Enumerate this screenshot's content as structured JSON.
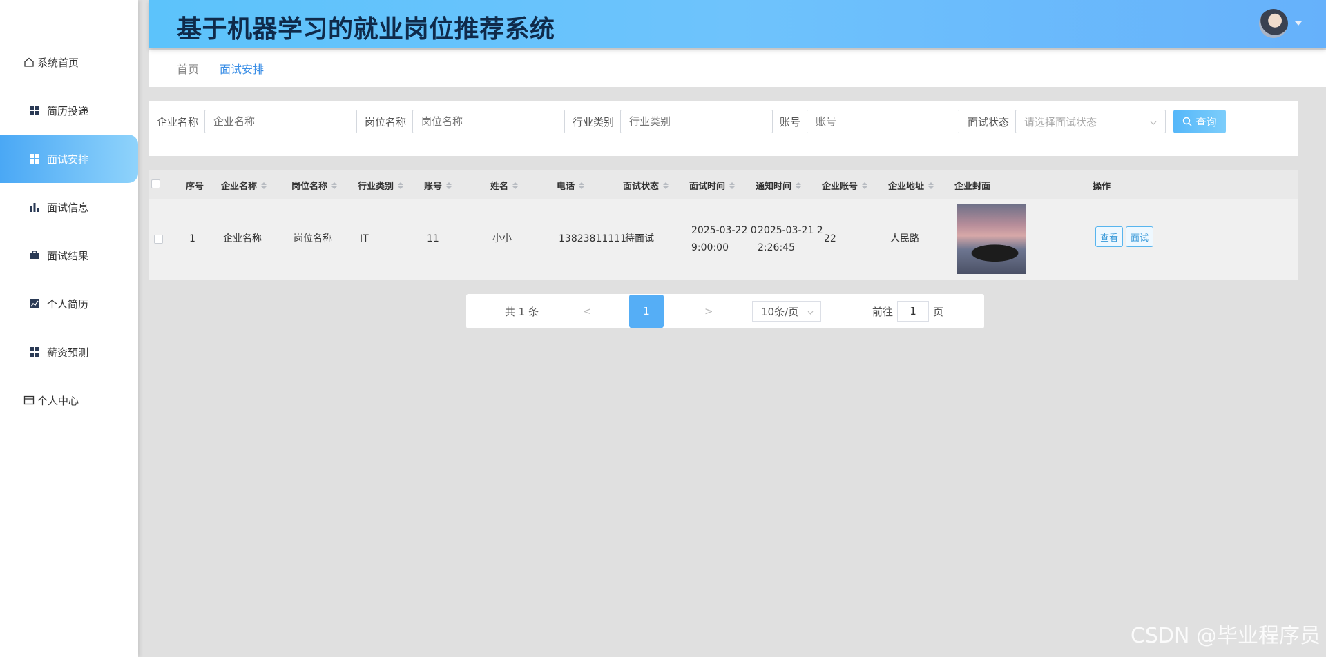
{
  "app": {
    "title": "基于机器学习的就业岗位推荐系统"
  },
  "sidebar": {
    "items": [
      {
        "label": "系统首页",
        "icon": "home-icon"
      },
      {
        "label": "简历投递",
        "icon": "grid-icon"
      },
      {
        "label": "面试安排",
        "icon": "grid-icon",
        "active": true
      },
      {
        "label": "面试信息",
        "icon": "bar-chart-icon"
      },
      {
        "label": "面试结果",
        "icon": "briefcase-icon"
      },
      {
        "label": "个人简历",
        "icon": "line-chart-icon"
      },
      {
        "label": "薪资预测",
        "icon": "grid-icon"
      },
      {
        "label": "个人中心",
        "icon": "card-icon"
      }
    ]
  },
  "breadcrumb": {
    "home": "首页",
    "current": "面试安排"
  },
  "search": {
    "company_label": "企业名称",
    "company_placeholder": "企业名称",
    "position_label": "岗位名称",
    "position_placeholder": "岗位名称",
    "industry_label": "行业类别",
    "industry_placeholder": "行业类别",
    "account_label": "账号",
    "account_placeholder": "账号",
    "status_label": "面试状态",
    "status_placeholder": "请选择面试状态",
    "button_label": "查询"
  },
  "table": {
    "headers": {
      "index": "序号",
      "company": "企业名称",
      "position": "岗位名称",
      "industry": "行业类别",
      "account": "账号",
      "name": "姓名",
      "phone": "电话",
      "status": "面试状态",
      "interview_time": "面试时间",
      "notice_time": "通知时间",
      "company_account": "企业账号",
      "company_address": "企业地址",
      "company_cover": "企业封面",
      "actions": "操作"
    },
    "rows": [
      {
        "index": "1",
        "company": "企业名称",
        "position": "岗位名称",
        "industry": "IT",
        "account": "11",
        "name": "小小",
        "phone": "13823811111",
        "status": "待面试",
        "interview_time_line1": "2025-03-22 0",
        "interview_time_line2": "9:00:00",
        "notice_time_line1": "2025-03-21 2",
        "notice_time_line2": "2:26:45",
        "company_account": "22",
        "company_address": "人民路",
        "view_label": "查看",
        "interview_label": "面试"
      }
    ]
  },
  "pagination": {
    "total": "共 1 条",
    "prev": "<",
    "current_page": "1",
    "next": ">",
    "page_size": "10条/页",
    "goto_prefix": "前往",
    "goto_value": "1",
    "goto_suffix": "页"
  },
  "watermark": "CSDN @毕业程序员"
}
